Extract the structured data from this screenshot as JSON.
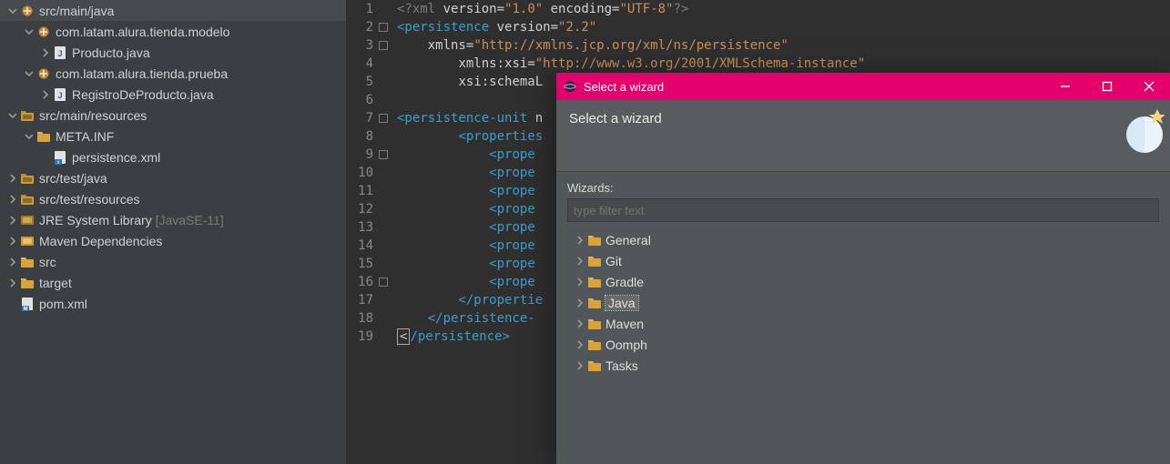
{
  "sidebar": {
    "items": [
      {
        "indent": 1,
        "twist": "down",
        "icon": "package",
        "label": "src/main/java"
      },
      {
        "indent": 2,
        "twist": "down",
        "icon": "package",
        "label": "com.latam.alura.tienda.modelo"
      },
      {
        "indent": 3,
        "twist": "right",
        "icon": "jfile",
        "label": "Producto.java"
      },
      {
        "indent": 2,
        "twist": "down",
        "icon": "package",
        "label": "com.latam.alura.tienda.prueba"
      },
      {
        "indent": 3,
        "twist": "right",
        "icon": "jfile",
        "label": "RegistroDeProducto.java"
      },
      {
        "indent": 1,
        "twist": "down",
        "icon": "srcfolder",
        "label": "src/main/resources"
      },
      {
        "indent": 2,
        "twist": "down",
        "icon": "folder",
        "label": "META.INF"
      },
      {
        "indent": 3,
        "twist": "none",
        "icon": "xmlfile",
        "label": "persistence.xml"
      },
      {
        "indent": 1,
        "twist": "right",
        "icon": "srcfolder",
        "label": "src/test/java"
      },
      {
        "indent": 1,
        "twist": "right",
        "icon": "srcfolder",
        "label": "src/test/resources"
      },
      {
        "indent": 1,
        "twist": "right",
        "icon": "jre",
        "label": "JRE System Library",
        "suffix": "[JavaSE-11]"
      },
      {
        "indent": 1,
        "twist": "right",
        "icon": "jar",
        "label": "Maven Dependencies"
      },
      {
        "indent": 1,
        "twist": "right",
        "icon": "folder",
        "label": "src"
      },
      {
        "indent": 1,
        "twist": "right",
        "icon": "folder",
        "label": "target"
      },
      {
        "indent": 1,
        "twist": "none",
        "icon": "mfile",
        "label": "pom.xml"
      }
    ]
  },
  "editor": {
    "lines": [
      {
        "n": "1",
        "fold": "",
        "segs": [
          {
            "c": "t-pi",
            "t": "<?xml "
          },
          {
            "c": "t-attr",
            "t": "version"
          },
          {
            "c": "t-eq",
            "t": "="
          },
          {
            "c": "t-str",
            "t": "\"1.0\""
          },
          {
            "c": "t-attr",
            "t": " encoding"
          },
          {
            "c": "t-eq",
            "t": "="
          },
          {
            "c": "t-str",
            "t": "\"UTF-8\""
          },
          {
            "c": "t-pi",
            "t": "?>"
          }
        ]
      },
      {
        "n": "2",
        "fold": "-",
        "segs": [
          {
            "c": "t-tag",
            "t": "<persistence "
          },
          {
            "c": "t-attr",
            "t": "version"
          },
          {
            "c": "t-eq",
            "t": "="
          },
          {
            "c": "t-str",
            "t": "\"2.2\""
          }
        ]
      },
      {
        "n": "3",
        "fold": "-",
        "segs": [
          {
            "c": "",
            "t": "    "
          },
          {
            "c": "t-attr",
            "t": "xmlns"
          },
          {
            "c": "t-eq",
            "t": "="
          },
          {
            "c": "t-str",
            "t": "\"http://xmlns.jcp.org/xml/ns/persistence\""
          }
        ]
      },
      {
        "n": "4",
        "fold": "",
        "segs": [
          {
            "c": "",
            "t": "        "
          },
          {
            "c": "t-attr",
            "t": "xmlns:xsi"
          },
          {
            "c": "t-eq",
            "t": "="
          },
          {
            "c": "t-str",
            "t": "\"http://www.w3.org/2001/XMLSchema-instance\""
          }
        ]
      },
      {
        "n": "5",
        "fold": "",
        "segs": [
          {
            "c": "",
            "t": "        "
          },
          {
            "c": "t-attr",
            "t": "xsi:schemaL"
          }
        ]
      },
      {
        "n": "6",
        "fold": "",
        "segs": []
      },
      {
        "n": "7",
        "fold": "-",
        "segs": [
          {
            "c": "t-tag",
            "t": "<persistence-unit "
          },
          {
            "c": "t-attr",
            "t": "n"
          }
        ]
      },
      {
        "n": "8",
        "fold": "",
        "segs": [
          {
            "c": "",
            "t": "        "
          },
          {
            "c": "t-tag",
            "t": "<properties"
          }
        ]
      },
      {
        "n": "9",
        "fold": "-",
        "segs": [
          {
            "c": "",
            "t": "            "
          },
          {
            "c": "t-tag",
            "t": "<prope"
          }
        ]
      },
      {
        "n": "10",
        "fold": "",
        "segs": [
          {
            "c": "",
            "t": "            "
          },
          {
            "c": "t-tag",
            "t": "<prope"
          }
        ]
      },
      {
        "n": "11",
        "fold": "",
        "segs": [
          {
            "c": "",
            "t": "            "
          },
          {
            "c": "t-tag",
            "t": "<prope"
          }
        ]
      },
      {
        "n": "12",
        "fold": "",
        "segs": [
          {
            "c": "",
            "t": "            "
          },
          {
            "c": "t-tag",
            "t": "<prope"
          }
        ]
      },
      {
        "n": "13",
        "fold": "",
        "segs": [
          {
            "c": "",
            "t": "            "
          },
          {
            "c": "t-tag",
            "t": "<prope"
          }
        ]
      },
      {
        "n": "14",
        "fold": "",
        "segs": [
          {
            "c": "",
            "t": "            "
          },
          {
            "c": "t-tag",
            "t": "<prope"
          }
        ]
      },
      {
        "n": "15",
        "fold": "",
        "segs": [
          {
            "c": "",
            "t": "            "
          },
          {
            "c": "t-tag",
            "t": "<prope"
          }
        ]
      },
      {
        "n": "16",
        "fold": "-",
        "segs": [
          {
            "c": "",
            "t": "            "
          },
          {
            "c": "t-tag",
            "t": "<prope"
          }
        ]
      },
      {
        "n": "17",
        "fold": "",
        "segs": [
          {
            "c": "",
            "t": "        "
          },
          {
            "c": "t-tag",
            "t": "</propertie"
          }
        ]
      },
      {
        "n": "18",
        "fold": "",
        "segs": [
          {
            "c": "",
            "t": "    "
          },
          {
            "c": "t-tag",
            "t": "</persistence-"
          }
        ]
      },
      {
        "n": "19",
        "fold": "",
        "caret": true,
        "segs": [
          {
            "c": "t-tag",
            "t": "/persistence>"
          }
        ]
      }
    ]
  },
  "dialog": {
    "title": "Select a wizard",
    "heading": "Select a wizard",
    "wizards_label": "Wizards:",
    "filter_placeholder": "type filter text",
    "categories": [
      {
        "label": "General",
        "selected": false
      },
      {
        "label": "Git",
        "selected": false
      },
      {
        "label": "Gradle",
        "selected": false
      },
      {
        "label": "Java",
        "selected": true
      },
      {
        "label": "Maven",
        "selected": false
      },
      {
        "label": "Oomph",
        "selected": false
      },
      {
        "label": "Tasks",
        "selected": false
      }
    ]
  }
}
